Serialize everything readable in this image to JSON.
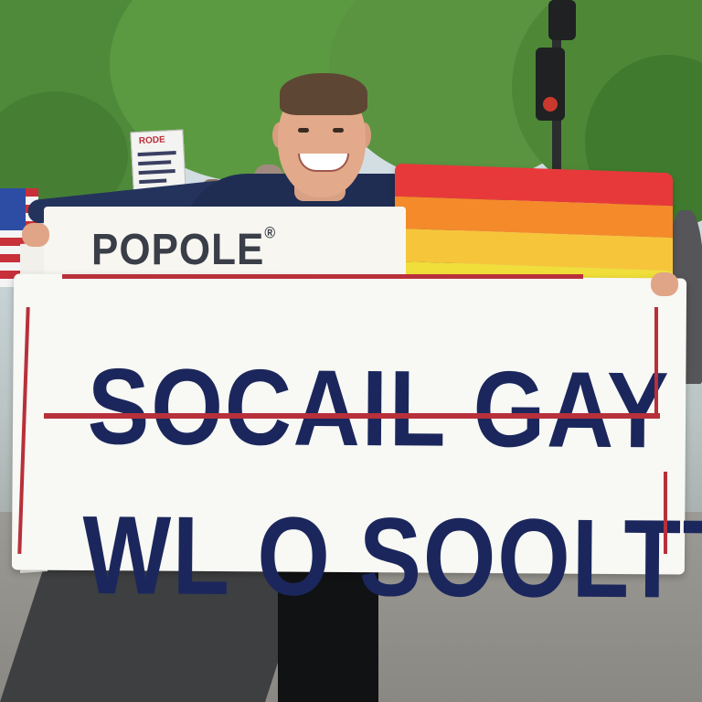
{
  "banner": {
    "tab_text": "POPOLE",
    "tab_mark": "®",
    "line1": "SOCAIL GAY",
    "line2": "WL O SOOLTTY"
  },
  "background_sign": {
    "headline": "RODE"
  },
  "colors": {
    "banner_text": "#1b275c",
    "banner_rule": "#b8303a",
    "banner_paper": "#f8f8f4",
    "shirt": "#1f2d52",
    "foliage": "#4f8a3a",
    "rainbow": [
      "#e8393a",
      "#f48a2a",
      "#f7c53a",
      "#f0de3a"
    ]
  }
}
